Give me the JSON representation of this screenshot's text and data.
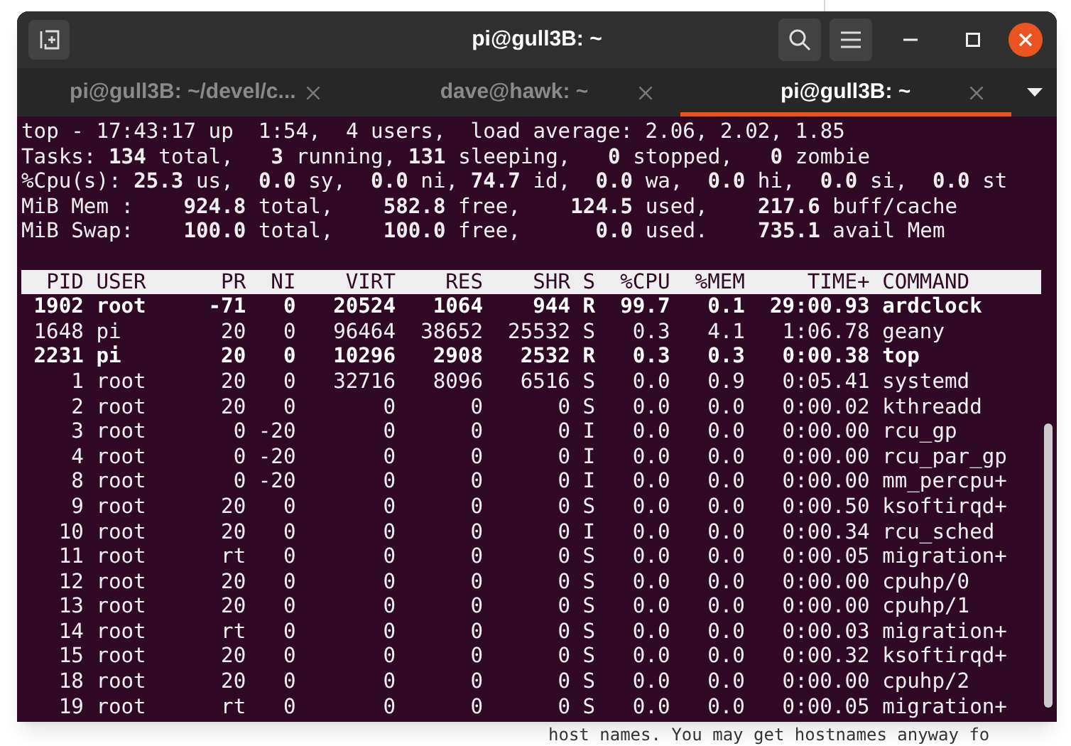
{
  "window": {
    "title": "pi@gull3B: ~"
  },
  "tabs": [
    {
      "label": "pi@gull3B: ~/devel/c...",
      "selected": false
    },
    {
      "label": "dave@hawk: ~",
      "selected": false
    },
    {
      "label": "pi@gull3B: ~",
      "selected": true
    }
  ],
  "summary": [
    "top - 17:43:17 up  1:54,  4 users,  load average: 2.06, 2.02, 1.85",
    "Tasks: **134** total,   **3** running, **131** sleeping,   **0** stopped,   **0** zombie",
    "%Cpu(s): **25.3** us,  **0.0** sy,  **0.0** ni, **74.7** id,  **0.0** wa,  **0.0** hi,  **0.0** si,  **0.0** st",
    "MiB Mem :    **924.8** total,    **582.8** free,    **124.5** used,    **217.6** buff/cache",
    "MiB Swap:    **100.0** total,    **100.0** free,      **0.0** used.    **735.1** avail Mem"
  ],
  "table": {
    "columns": [
      "PID",
      "USER",
      "PR",
      "NI",
      "VIRT",
      "RES",
      "SHR",
      "S",
      "%CPU",
      "%MEM",
      "TIME+",
      "COMMAND"
    ],
    "rows": [
      {
        "bold": true,
        "cells": [
          "1902",
          "root",
          "-71",
          "0",
          "20524",
          "1064",
          "944",
          "R",
          "99.7",
          "0.1",
          "29:00.93",
          "ardclock"
        ]
      },
      {
        "bold": false,
        "cells": [
          "1648",
          "pi",
          "20",
          "0",
          "96464",
          "38652",
          "25532",
          "S",
          "0.3",
          "4.1",
          "1:06.78",
          "geany"
        ]
      },
      {
        "bold": true,
        "cells": [
          "2231",
          "pi",
          "20",
          "0",
          "10296",
          "2908",
          "2532",
          "R",
          "0.3",
          "0.3",
          "0:00.38",
          "top"
        ]
      },
      {
        "bold": false,
        "cells": [
          "1",
          "root",
          "20",
          "0",
          "32716",
          "8096",
          "6516",
          "S",
          "0.0",
          "0.9",
          "0:05.41",
          "systemd"
        ]
      },
      {
        "bold": false,
        "cells": [
          "2",
          "root",
          "20",
          "0",
          "0",
          "0",
          "0",
          "S",
          "0.0",
          "0.0",
          "0:00.02",
          "kthreadd"
        ]
      },
      {
        "bold": false,
        "cells": [
          "3",
          "root",
          "0",
          "-20",
          "0",
          "0",
          "0",
          "I",
          "0.0",
          "0.0",
          "0:00.00",
          "rcu_gp"
        ]
      },
      {
        "bold": false,
        "cells": [
          "4",
          "root",
          "0",
          "-20",
          "0",
          "0",
          "0",
          "I",
          "0.0",
          "0.0",
          "0:00.00",
          "rcu_par_gp"
        ]
      },
      {
        "bold": false,
        "cells": [
          "8",
          "root",
          "0",
          "-20",
          "0",
          "0",
          "0",
          "I",
          "0.0",
          "0.0",
          "0:00.00",
          "mm_percpu+"
        ]
      },
      {
        "bold": false,
        "cells": [
          "9",
          "root",
          "20",
          "0",
          "0",
          "0",
          "0",
          "S",
          "0.0",
          "0.0",
          "0:00.50",
          "ksoftirqd+"
        ]
      },
      {
        "bold": false,
        "cells": [
          "10",
          "root",
          "20",
          "0",
          "0",
          "0",
          "0",
          "I",
          "0.0",
          "0.0",
          "0:00.34",
          "rcu_sched"
        ]
      },
      {
        "bold": false,
        "cells": [
          "11",
          "root",
          "rt",
          "0",
          "0",
          "0",
          "0",
          "S",
          "0.0",
          "0.0",
          "0:00.05",
          "migration+"
        ]
      },
      {
        "bold": false,
        "cells": [
          "12",
          "root",
          "20",
          "0",
          "0",
          "0",
          "0",
          "S",
          "0.0",
          "0.0",
          "0:00.00",
          "cpuhp/0"
        ]
      },
      {
        "bold": false,
        "cells": [
          "13",
          "root",
          "20",
          "0",
          "0",
          "0",
          "0",
          "S",
          "0.0",
          "0.0",
          "0:00.00",
          "cpuhp/1"
        ]
      },
      {
        "bold": false,
        "cells": [
          "14",
          "root",
          "rt",
          "0",
          "0",
          "0",
          "0",
          "S",
          "0.0",
          "0.0",
          "0:00.03",
          "migration+"
        ]
      },
      {
        "bold": false,
        "cells": [
          "15",
          "root",
          "20",
          "0",
          "0",
          "0",
          "0",
          "S",
          "0.0",
          "0.0",
          "0:00.32",
          "ksoftirqd+"
        ]
      },
      {
        "bold": false,
        "cells": [
          "18",
          "root",
          "20",
          "0",
          "0",
          "0",
          "0",
          "S",
          "0.0",
          "0.0",
          "0:00.00",
          "cpuhp/2"
        ]
      },
      {
        "bold": false,
        "cells": [
          "19",
          "root",
          "rt",
          "0",
          "0",
          "0",
          "0",
          "S",
          "0.0",
          "0.0",
          "0:00.05",
          "migration+"
        ]
      }
    ]
  },
  "background_text": "host names. You may get hostnames anyway fo"
}
